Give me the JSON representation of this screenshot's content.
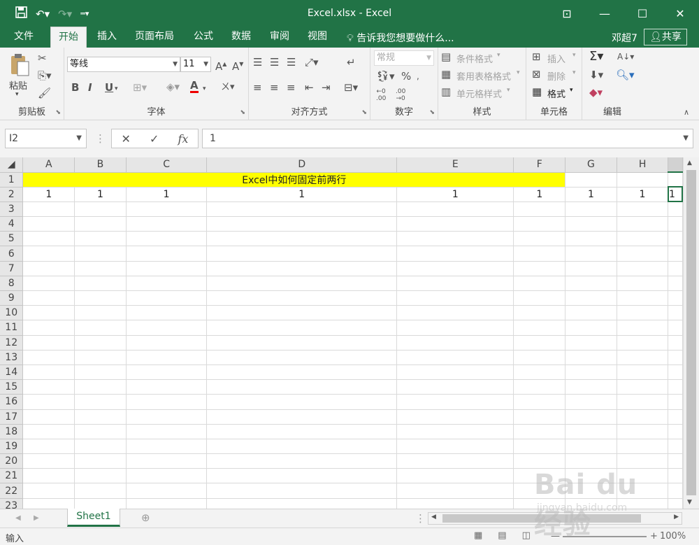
{
  "titlebar": {
    "title": "Excel.xlsx - Excel",
    "save_icon": "save-icon",
    "undo_icon": "undo-icon",
    "redo_icon": "redo-icon",
    "customize_icon": "customize-qat-icon"
  },
  "tabs": [
    {
      "label": "文件",
      "active": false
    },
    {
      "label": "开始",
      "active": true
    },
    {
      "label": "插入",
      "active": false
    },
    {
      "label": "页面布局",
      "active": false
    },
    {
      "label": "公式",
      "active": false
    },
    {
      "label": "数据",
      "active": false
    },
    {
      "label": "审阅",
      "active": false
    },
    {
      "label": "视图",
      "active": false
    }
  ],
  "tellme": "告诉我您想要做什么...",
  "user": "邓超7",
  "share": "共享",
  "ribbon": {
    "clipboard": {
      "label": "剪贴板",
      "paste": "粘贴"
    },
    "font": {
      "label": "字体",
      "font_name": "等线",
      "font_size": "11",
      "bold": "B",
      "italic": "I",
      "underline": "U",
      "font_color": "A"
    },
    "alignment": {
      "label": "对齐方式"
    },
    "number": {
      "label": "数字",
      "format": "常规",
      "percent": "%"
    },
    "styles": {
      "label": "样式",
      "conditional": "条件格式",
      "table": "套用表格格式",
      "cell": "单元格样式"
    },
    "cells": {
      "label": "单元格",
      "insert": "插入",
      "delete": "删除",
      "format": "格式"
    },
    "editing": {
      "label": "编辑"
    }
  },
  "formula_bar": {
    "name_box": "I2",
    "content": "1",
    "fx": "fx"
  },
  "sheet": {
    "columns": [
      "A",
      "B",
      "C",
      "D",
      "E",
      "F",
      "G",
      "H"
    ],
    "merged_title": "Excel中如何固定前两行",
    "row2": [
      "1",
      "1",
      "1",
      "1",
      "1",
      "1",
      "1",
      "1",
      "1"
    ],
    "rows": [
      "1",
      "2",
      "3",
      "4",
      "5",
      "6",
      "7",
      "8",
      "9",
      "10",
      "11",
      "12",
      "13",
      "14",
      "15",
      "16",
      "17",
      "18",
      "19",
      "20",
      "21",
      "22",
      "23"
    ]
  },
  "sheet_tabs": [
    {
      "label": "Sheet1",
      "active": true
    }
  ],
  "status": {
    "ready": "输入",
    "zoom": "100%"
  },
  "watermark": {
    "line1": "Bai du 经验",
    "line2": "jingyan.baidu.com"
  }
}
